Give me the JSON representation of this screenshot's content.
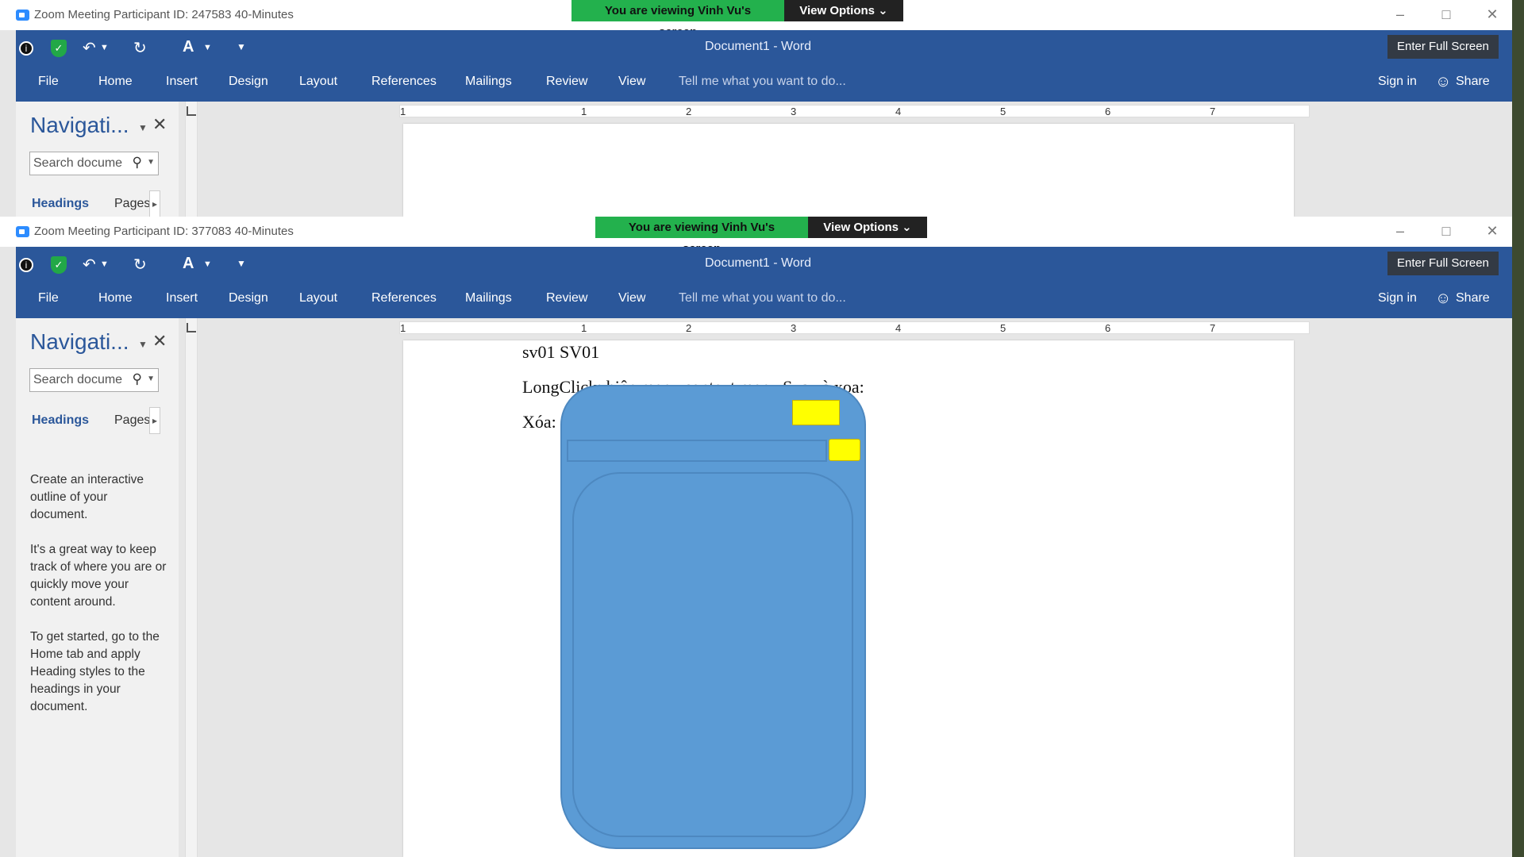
{
  "zoom": {
    "win1_title": "Zoom Meeting Participant ID: 247583   40-Minutes",
    "win2_title": "Zoom Meeting Participant ID: 377083   40-Minutes",
    "banner_text": "You are viewing Vinh Vu's screen",
    "view_options": "View Options ⌄",
    "enter_full_screen": "Enter Full Screen"
  },
  "word": {
    "title_win1": "Document1 - Word",
    "title_win2": "Document1 - Word",
    "tabs": [
      "File",
      "Home",
      "Insert",
      "Design",
      "Layout",
      "References",
      "Mailings",
      "Review",
      "View"
    ],
    "tell_me": "Tell me what you want to do...",
    "sign_in": "Sign in",
    "share": "Share",
    "ruler_numbers": [
      "1",
      "1",
      "2",
      "3",
      "4",
      "5",
      "6",
      "7"
    ]
  },
  "nav": {
    "title": "Navigati...",
    "search_placeholder": "Search docume",
    "tab_headings": "Headings",
    "tab_pages": "Pages",
    "help_p1": "Create an interactive outline of your document.",
    "help_p2": "It's a great way to keep track of where you are or quickly move your content around.",
    "help_p3": "To get started, go to the Home tab and apply Heading styles to the headings in your document."
  },
  "document": {
    "line1": "sv01 SV01",
    "line2": "LongClick: hiện menu context menu Sua và xoa:",
    "line3": "Xóa:"
  },
  "colors": {
    "word_blue": "#2b579a",
    "zoom_green": "#23b14d",
    "shape_blue": "#5b9bd5",
    "shape_yellow": "#ffff00"
  }
}
